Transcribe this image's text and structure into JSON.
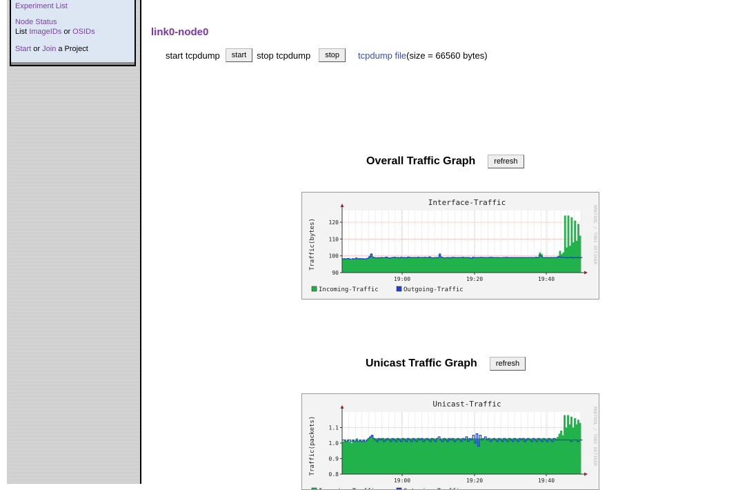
{
  "menu": {
    "experiment_list": "Experiment List",
    "node_status": "Node Status",
    "list_prefix": "List ",
    "imageids": "ImageIDs",
    "or": " or ",
    "osids": "OSIDs",
    "start": "Start",
    "or2": " or ",
    "join": "Join",
    "a_project": " a Project"
  },
  "page_title": "link0-node0",
  "tcpdump": {
    "start_text": "start tcpdump",
    "start_button": "start",
    "stop_text": "stop tcpdump",
    "stop_button": "stop",
    "file_link": "tcpdump file",
    "size_text": " (size = 66560 bytes)"
  },
  "sections": [
    {
      "heading": "Overall Traffic Graph",
      "refresh_label": "refresh"
    },
    {
      "heading": "Unicast Traffic Graph",
      "refresh_label": "refresh"
    }
  ],
  "colors": {
    "incoming": "#22b24c",
    "outgoing": "#1c3fd6",
    "title_purple": "#7b35a5",
    "link_blue": "#3a4fb0"
  },
  "chart_data": [
    {
      "type": "area",
      "title": "Interface-Traffic",
      "ylabel": "Traffic(bytes)",
      "watermark": "RRDTOOL / TOBI OETIKER",
      "x_ticks": [
        "19:00",
        "19:20",
        "19:40"
      ],
      "y_ticks": [
        90,
        100,
        110,
        120
      ],
      "ylim": [
        90,
        127
      ],
      "series": [
        {
          "name": "Incoming-Traffic",
          "color": "#22b24c",
          "values": [
            98,
            98.5,
            98.2,
            98.6,
            98,
            97.5,
            98.4,
            98.2,
            99,
            98,
            98.6,
            98.3,
            98.5,
            98,
            98.4,
            98.8,
            100,
            101.5,
            99.5,
            99,
            98.7,
            99,
            98.8,
            99.2,
            99,
            99,
            99.5,
            99,
            98.5,
            99,
            99.2,
            99.4,
            99,
            99.1,
            98.8,
            99.3,
            99,
            99.2,
            98.9,
            99.5,
            99.3,
            99,
            99.1,
            99.2,
            99,
            99.4,
            99.2,
            99.1,
            99,
            99.3,
            99.2,
            99.1,
            99.6,
            99,
            98.8,
            99,
            99.2,
            99,
            101.5,
            99.5,
            99,
            98.7,
            99,
            99.2,
            98.8,
            99.1,
            99.3,
            99.2,
            99,
            99.1,
            99,
            99.2,
            99.4,
            99,
            99.2,
            99.1,
            99,
            98.5,
            99.4,
            99.2,
            99,
            99.1,
            99.2,
            99.3,
            99,
            99.2,
            99.1,
            99,
            99.3,
            99.4,
            99.2,
            99,
            99.2,
            99.1,
            99,
            99,
            99.2,
            99.1,
            99.3,
            99.2,
            99,
            99.2,
            99.1,
            99,
            99.1,
            99.2,
            99,
            99.1,
            99,
            99.2,
            99,
            99.1,
            99.2,
            99.1,
            99,
            99.2,
            99.4,
            99,
            102,
            101,
            99.2,
            99,
            99.1,
            99,
            99.2,
            99.1,
            99,
            99.2,
            99.1,
            100,
            103,
            101,
            102,
            124,
            105,
            124,
            106,
            123,
            108,
            121,
            109,
            119,
            112
          ]
        },
        {
          "name": "Outgoing-Traffic",
          "color": "#1c3fd6",
          "values": [
            98.2,
            98.3,
            98.1,
            98.4,
            98.2,
            97.9,
            98.3,
            98.1,
            98.6,
            98.2,
            98.4,
            98.2,
            98.3,
            98.1,
            98.3,
            98.5,
            99.3,
            100.8,
            99.2,
            98.9,
            98.7,
            98.9,
            98.8,
            99,
            98.9,
            98.9,
            99.2,
            98.9,
            98.6,
            98.9,
            99,
            99.1,
            98.9,
            99,
            98.8,
            99.1,
            98.9,
            99,
            98.8,
            99.2,
            99.1,
            98.9,
            99,
            99,
            98.9,
            99.1,
            99,
            99,
            98.9,
            99.1,
            99,
            99,
            99.3,
            98.9,
            98.8,
            98.9,
            99,
            98.9,
            100.6,
            99.2,
            98.9,
            98.7,
            98.9,
            99,
            98.8,
            99,
            99.1,
            99,
            98.9,
            99,
            98.9,
            99,
            99.1,
            98.9,
            99,
            99,
            98.9,
            98.6,
            99.1,
            99,
            98.9,
            99,
            99,
            99.1,
            98.9,
            99,
            99,
            98.9,
            99.1,
            99.1,
            99,
            98.9,
            99,
            99,
            98.9,
            98.9,
            99,
            99,
            99.1,
            99,
            98.9,
            99,
            99,
            98.9,
            99,
            99,
            98.9,
            99,
            98.9,
            99,
            98.9,
            99,
            99,
            99,
            98.9,
            99,
            99.1,
            98.9,
            100.5,
            99.8,
            99,
            98.9,
            99,
            98.9,
            99,
            99,
            98.9,
            99,
            99,
            99.2,
            99.4,
            99,
            99.1,
            99,
            98.8,
            99,
            98.9,
            99.1,
            98.8,
            99,
            98.9,
            99,
            98.8,
            99
          ]
        }
      ]
    },
    {
      "type": "area",
      "title": "Unicast-Traffic",
      "ylabel": "Traffic(packets)",
      "watermark": "RRDTOOL / TOBI OETIKER",
      "x_ticks": [
        "19:00",
        "19:20",
        "19:40"
      ],
      "y_ticks": [
        "0.8",
        "0.9",
        "1.0",
        "1.1"
      ],
      "ylim": [
        0.8,
        1.2
      ],
      "series": [
        {
          "name": "Incoming-Traffic",
          "color": "#22b24c",
          "values": [
            1.01,
            1.02,
            1.01,
            1.02,
            1.01,
            1.0,
            1.02,
            1.01,
            1.03,
            1.01,
            1.02,
            1.01,
            1.02,
            1.01,
            1.02,
            1.03,
            1.04,
            1.05,
            1.03,
            1.03,
            1.03,
            1.03,
            1.03,
            1.03,
            1.03,
            1.03,
            1.03,
            1.03,
            1.03,
            1.03,
            1.03,
            1.03,
            1.03,
            1.03,
            1.03,
            1.03,
            1.03,
            1.03,
            1.03,
            1.03,
            1.03,
            1.03,
            1.03,
            1.03,
            1.03,
            1.03,
            1.03,
            1.03,
            1.03,
            1.03,
            1.03,
            1.03,
            1.03,
            1.03,
            1.03,
            1.03,
            1.03,
            1.03,
            1.03,
            1.03,
            1.03,
            1.03,
            1.03,
            1.03,
            1.03,
            1.03,
            1.03,
            1.03,
            1.03,
            1.03,
            1.03,
            1.03,
            1.03,
            1.03,
            1.03,
            1.03,
            1.03,
            1.03,
            1.03,
            1.03,
            1.03,
            1.03,
            1.03,
            1.03,
            1.03,
            1.03,
            1.03,
            1.03,
            1.03,
            1.03,
            1.03,
            1.03,
            1.03,
            1.03,
            1.03,
            1.03,
            1.03,
            1.03,
            1.03,
            1.03,
            1.03,
            1.03,
            1.03,
            1.03,
            1.03,
            1.03,
            1.03,
            1.03,
            1.03,
            1.03,
            1.03,
            1.03,
            1.03,
            1.03,
            1.03,
            1.03,
            1.03,
            1.03,
            1.03,
            1.03,
            1.03,
            1.03,
            1.03,
            1.03,
            1.03,
            1.04,
            1.06,
            1.08,
            1.05,
            1.18,
            1.1,
            1.18,
            1.12,
            1.17,
            1.1,
            1.16,
            1.12,
            1.15,
            1.13
          ]
        },
        {
          "name": "Outgoing-Traffic",
          "color": "#1c3fd6",
          "values": [
            1.02,
            1.02,
            1.01,
            1.02,
            1.02,
            1.01,
            1.02,
            1.01,
            1.02,
            1.01,
            1.02,
            1.01,
            1.02,
            1.01,
            1.02,
            1.03,
            1.04,
            1.05,
            1.03,
            1.02,
            1.01,
            1.03,
            1.02,
            1.03,
            1.01,
            1.02,
            1.03,
            1.02,
            1.01,
            1.03,
            1.02,
            1.01,
            1.03,
            1.02,
            1.01,
            1.03,
            1.02,
            1.01,
            1.03,
            1.02,
            1.01,
            1.03,
            1.02,
            1.01,
            1.03,
            1.02,
            1.03,
            1.01,
            1.02,
            1.03,
            1.02,
            1.01,
            1.03,
            1.02,
            1.01,
            1.03,
            1.04,
            1.02,
            1.01,
            1.03,
            1.02,
            1.01,
            1.03,
            1.02,
            1.03,
            1.01,
            1.02,
            1.03,
            1.02,
            1.01,
            1.03,
            1.02,
            1.04,
            1.01,
            1.03,
            1.02,
            1.05,
            1.0,
            1.06,
            0.98,
            1.05,
            1.02,
            1.03,
            1.04,
            1.02,
            1.03,
            1.01,
            1.02,
            1.03,
            1.02,
            1.01,
            1.03,
            1.02,
            1.01,
            1.03,
            1.02,
            1.01,
            1.03,
            1.02,
            1.01,
            1.03,
            1.02,
            1.01,
            1.03,
            1.02,
            1.03,
            1.01,
            1.02,
            1.03,
            1.02,
            1.01,
            1.03,
            1.02,
            1.01,
            1.03,
            1.02,
            1.01,
            1.03,
            1.02,
            1.01,
            1.03,
            1.02,
            1.01,
            1.03,
            1.02,
            1.02,
            1.02,
            1.02,
            1.02,
            1.02,
            1.02,
            1.02,
            1.02,
            1.01,
            1.02,
            1.02,
            1.02,
            1.01,
            1.02,
            1.02
          ]
        }
      ]
    }
  ]
}
